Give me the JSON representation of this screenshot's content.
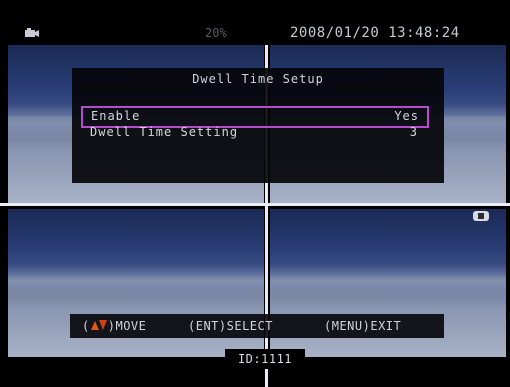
{
  "status": {
    "battery": "20%",
    "datetime": "2008/01/20 13:48:24",
    "camera_icon": "camera-icon",
    "record_icon": "record-icon"
  },
  "menu": {
    "title": "Dwell Time Setup",
    "items": [
      {
        "label": "Enable",
        "value": "Yes",
        "selected": true
      },
      {
        "label": "Dwell Time Setting",
        "value": "3",
        "selected": false
      }
    ]
  },
  "hints": {
    "move": "MOVE",
    "move_icon": "up-down-arrows-icon",
    "select": "(ENT)SELECT",
    "exit": "(MENU)EXIT"
  },
  "footer": {
    "id": "ID:1111"
  },
  "colors": {
    "highlight": "#b64ccd",
    "arrow_up": "#e05a10",
    "arrow_down": "#d04010"
  }
}
